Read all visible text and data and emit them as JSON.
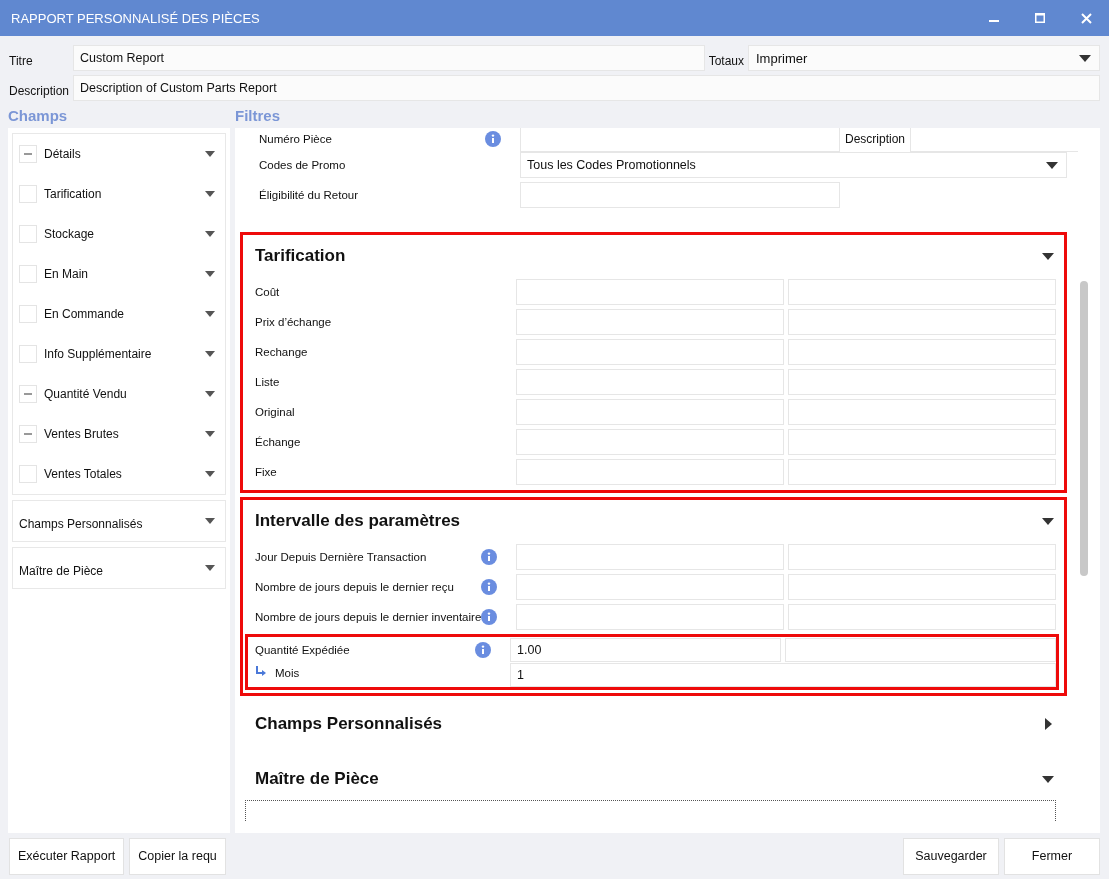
{
  "window": {
    "title": "RAPPORT PERSONNALISÉ DES PIÈCES"
  },
  "header": {
    "title_label": "Titre",
    "title_value": "Custom Report",
    "totals_label": "Totaux",
    "totals_value": "Imprimer",
    "description_label": "Description",
    "description_value": "Description of Custom Parts Report"
  },
  "fields_panel": {
    "heading": "Champs",
    "groups": [
      {
        "items": [
          {
            "label": "Détails",
            "partial": true
          },
          {
            "label": "Tarification",
            "partial": false
          },
          {
            "label": "Stockage",
            "partial": false
          },
          {
            "label": "En Main",
            "partial": false
          },
          {
            "label": "En Commande",
            "partial": false
          },
          {
            "label": "Info Supplémentaire",
            "partial": false
          },
          {
            "label": "Quantité Vendu",
            "partial": true
          },
          {
            "label": "Ventes Brutes",
            "partial": true
          },
          {
            "label": "Ventes Totales",
            "partial": false
          }
        ]
      },
      {
        "title": "Champs Personnalisés"
      },
      {
        "title": "Maître de Pièce"
      }
    ]
  },
  "filters_panel": {
    "heading": "Filtres",
    "top_rows": [
      {
        "kind": "split",
        "label": "Numéro Pièce",
        "info": true,
        "aux_label": "Description"
      },
      {
        "kind": "dropdown",
        "label": "Codes de Promo",
        "info": false,
        "value": "Tous les Codes Promotionnels"
      },
      {
        "kind": "single",
        "label": "Éligibilité du Retour",
        "info": false
      }
    ],
    "sections": [
      {
        "title": "Tarification",
        "expanded": true,
        "highlighted": true,
        "rows": [
          {
            "label": "Coût",
            "info": false,
            "highlighted": false
          },
          {
            "label": "Prix d’échange",
            "info": false,
            "highlighted": false
          },
          {
            "label": "Rechange",
            "info": false,
            "highlighted": false
          },
          {
            "label": "Liste",
            "info": false,
            "highlighted": false
          },
          {
            "label": "Original",
            "info": false,
            "highlighted": false
          },
          {
            "label": "Échange",
            "info": false,
            "highlighted": false
          },
          {
            "label": "Fixe",
            "info": false,
            "highlighted": false
          }
        ]
      },
      {
        "title": "Intervalle des paramètres",
        "expanded": true,
        "highlighted": true,
        "rows": [
          {
            "label": "Jour Depuis Dernière Transaction",
            "info": true,
            "highlighted": false
          },
          {
            "label": "Nombre de jours depuis le dernier reçu",
            "info": true,
            "highlighted": false
          },
          {
            "label": "Nombre de jours depuis le dernier inventaire",
            "info": true,
            "highlighted": false
          },
          {
            "label": "Quantité Expédiée",
            "info": true,
            "highlighted": true,
            "from": "1.00",
            "sub": {
              "label": "Mois",
              "value": "1"
            }
          }
        ]
      },
      {
        "title": "Champs Personnalisés",
        "expanded": false,
        "highlighted": false
      },
      {
        "title": "Maître de Pièce",
        "expanded": true,
        "highlighted": false
      }
    ]
  },
  "buttons_left": [
    "Exécuter Rapport",
    "Copier la requ"
  ],
  "buttons_right": [
    "Sauvegarder",
    "Fermer"
  ]
}
